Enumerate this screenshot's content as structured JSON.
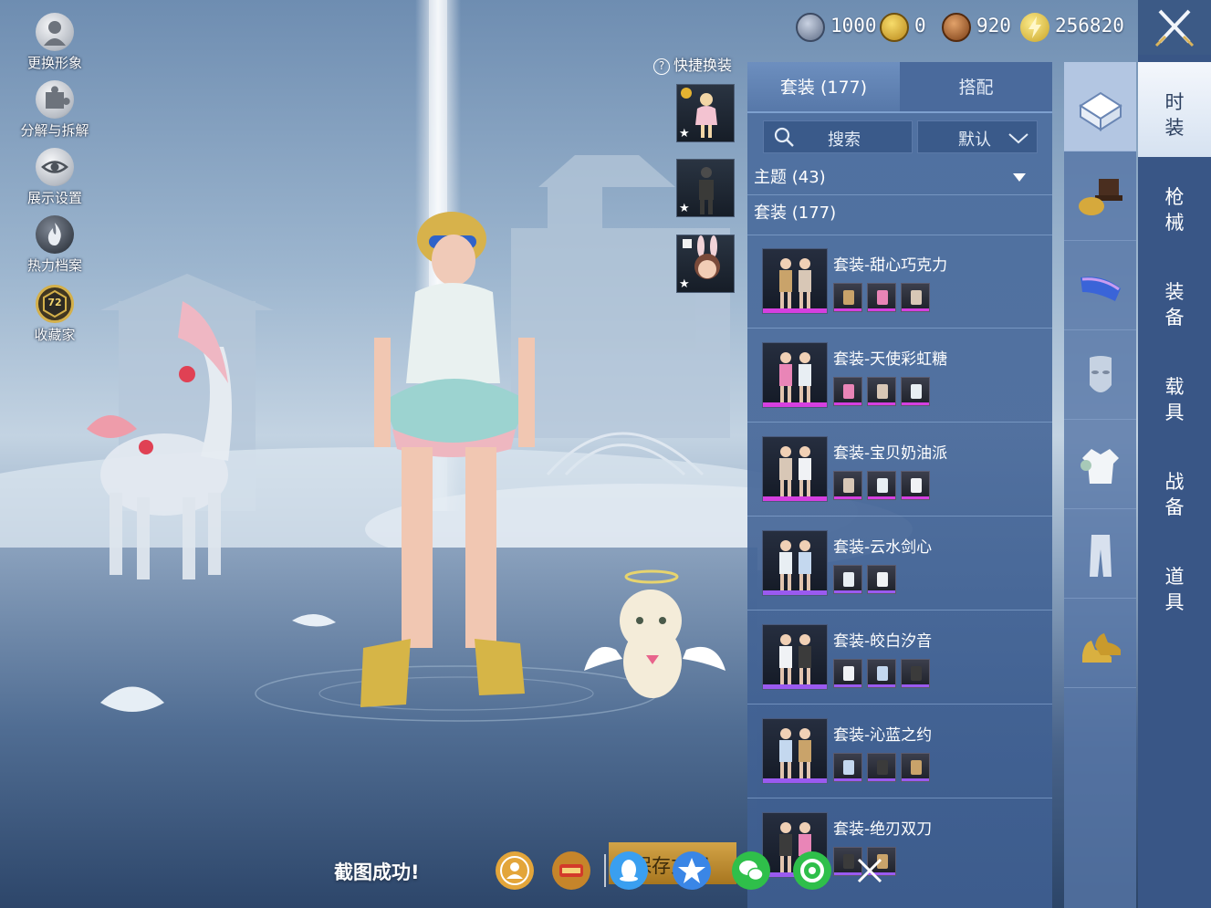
{
  "left_menu": [
    {
      "label": "更换形象",
      "icon": "avatar-icon"
    },
    {
      "label": "分解与拆解",
      "icon": "puzzle-icon"
    },
    {
      "label": "展示设置",
      "icon": "eye-icon"
    },
    {
      "label": "热力档案",
      "icon": "flame-icon"
    },
    {
      "label": "收藏家",
      "icon": "collector-badge-icon",
      "badge": "72"
    }
  ],
  "currency": [
    {
      "icon": "silver-coin-icon",
      "value": "1000",
      "color": "#8b97ad"
    },
    {
      "icon": "gold-coin-icon",
      "value": "0",
      "color": "#e1b530"
    },
    {
      "icon": "bronze-coin-icon",
      "value": "920",
      "color": "#b0652e"
    },
    {
      "icon": "lightning-coin-icon",
      "value": "256820",
      "color": "#e9c946"
    }
  ],
  "quick_change": {
    "title": "快捷换装"
  },
  "tabs": {
    "suits": "套装 (177)",
    "match": "搭配"
  },
  "search": {
    "placeholder": "搜索"
  },
  "sort": {
    "value": "默认"
  },
  "filters": {
    "theme": "主题 (43)",
    "suit": "套装 (177)"
  },
  "items": [
    {
      "name": "套装-甜心巧克力",
      "rarity": "#d53fe0",
      "minis": 3
    },
    {
      "name": "套装-天使彩虹糖",
      "rarity": "#d53fe0",
      "minis": 3
    },
    {
      "name": "套装-宝贝奶油派",
      "rarity": "#d53fe0",
      "minis": 3
    },
    {
      "name": "套装-云水剑心",
      "rarity": "#9a5af0",
      "minis": 2
    },
    {
      "name": "套装-皎白汐音",
      "rarity": "#9a5af0",
      "minis": 3
    },
    {
      "name": "套装-沁蓝之约",
      "rarity": "#9a5af0",
      "minis": 3
    },
    {
      "name": "套装-绝刃双刀",
      "rarity": "#9a5af0",
      "minis": 2
    }
  ],
  "categories": [
    "helmet-box-icon",
    "hat-mask-icon",
    "goggles-icon",
    "face-mask-icon",
    "outfit-icon",
    "pants-icon",
    "shoes-icon"
  ],
  "main_tabs": [
    "时装",
    "枪械",
    "装备",
    "载具",
    "战备",
    "道具"
  ],
  "toast": "截图成功!",
  "save_button": "保存方案",
  "share": [
    {
      "icon": "friend-share-icon",
      "color": "#e3a53a"
    },
    {
      "icon": "game-logo-icon",
      "color": "#c6852a"
    },
    {
      "icon": "qq-icon",
      "color": "#3a9ff0"
    },
    {
      "icon": "qzone-icon",
      "color": "#3a86e6"
    },
    {
      "icon": "wechat-icon",
      "color": "#2fbf4a"
    },
    {
      "icon": "moments-icon",
      "color": "#2fbf4a"
    }
  ]
}
